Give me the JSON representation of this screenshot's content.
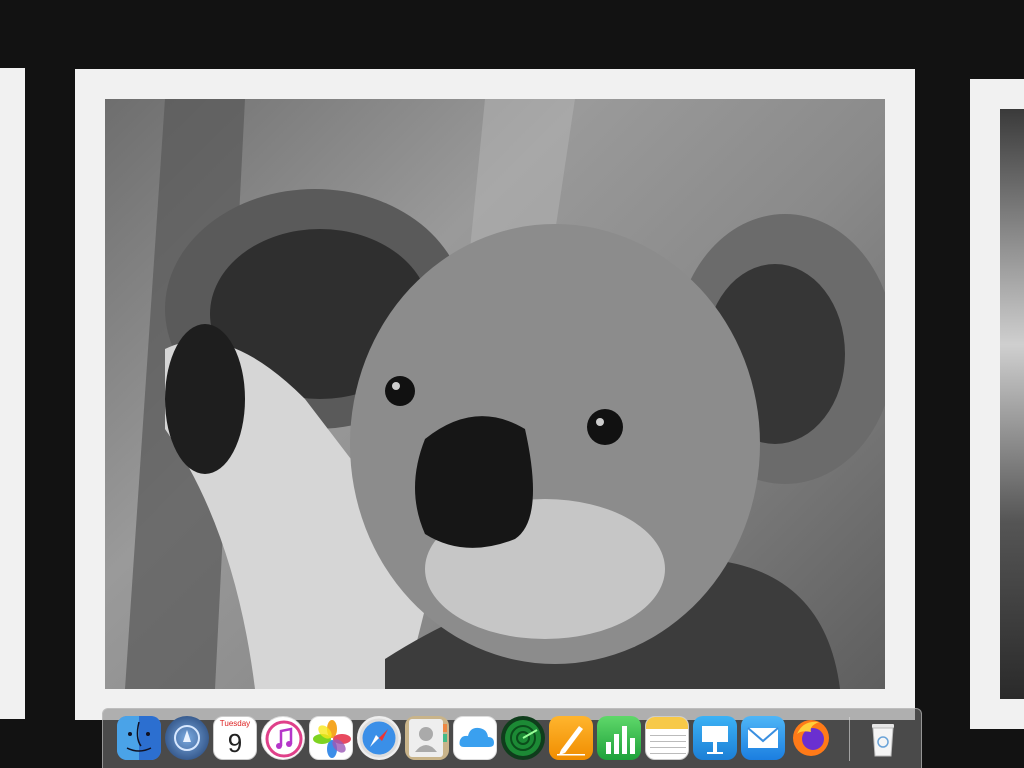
{
  "viewer": {
    "main_photo": {
      "subject": "koala-photo",
      "color_mode": "grayscale"
    }
  },
  "dock": {
    "items": [
      {
        "name": "finder",
        "icon": "finder-icon"
      },
      {
        "name": "launchpad",
        "icon": "launchpad-icon"
      },
      {
        "name": "calendar",
        "icon": "calendar-icon",
        "day_label": "Tuesday",
        "date": "9"
      },
      {
        "name": "itunes",
        "icon": "itunes-icon"
      },
      {
        "name": "photos",
        "icon": "photos-icon"
      },
      {
        "name": "safari",
        "icon": "safari-icon"
      },
      {
        "name": "contacts",
        "icon": "contacts-icon"
      },
      {
        "name": "icloud",
        "icon": "icloud-icon"
      },
      {
        "name": "find-my",
        "icon": "radar-icon"
      },
      {
        "name": "pages",
        "icon": "pages-icon"
      },
      {
        "name": "numbers",
        "icon": "numbers-icon"
      },
      {
        "name": "notes",
        "icon": "notes-icon"
      },
      {
        "name": "keynote",
        "icon": "keynote-icon"
      },
      {
        "name": "mail",
        "icon": "mail-icon"
      },
      {
        "name": "firefox",
        "icon": "firefox-icon"
      },
      {
        "name": "trash",
        "icon": "trash-icon"
      }
    ]
  }
}
